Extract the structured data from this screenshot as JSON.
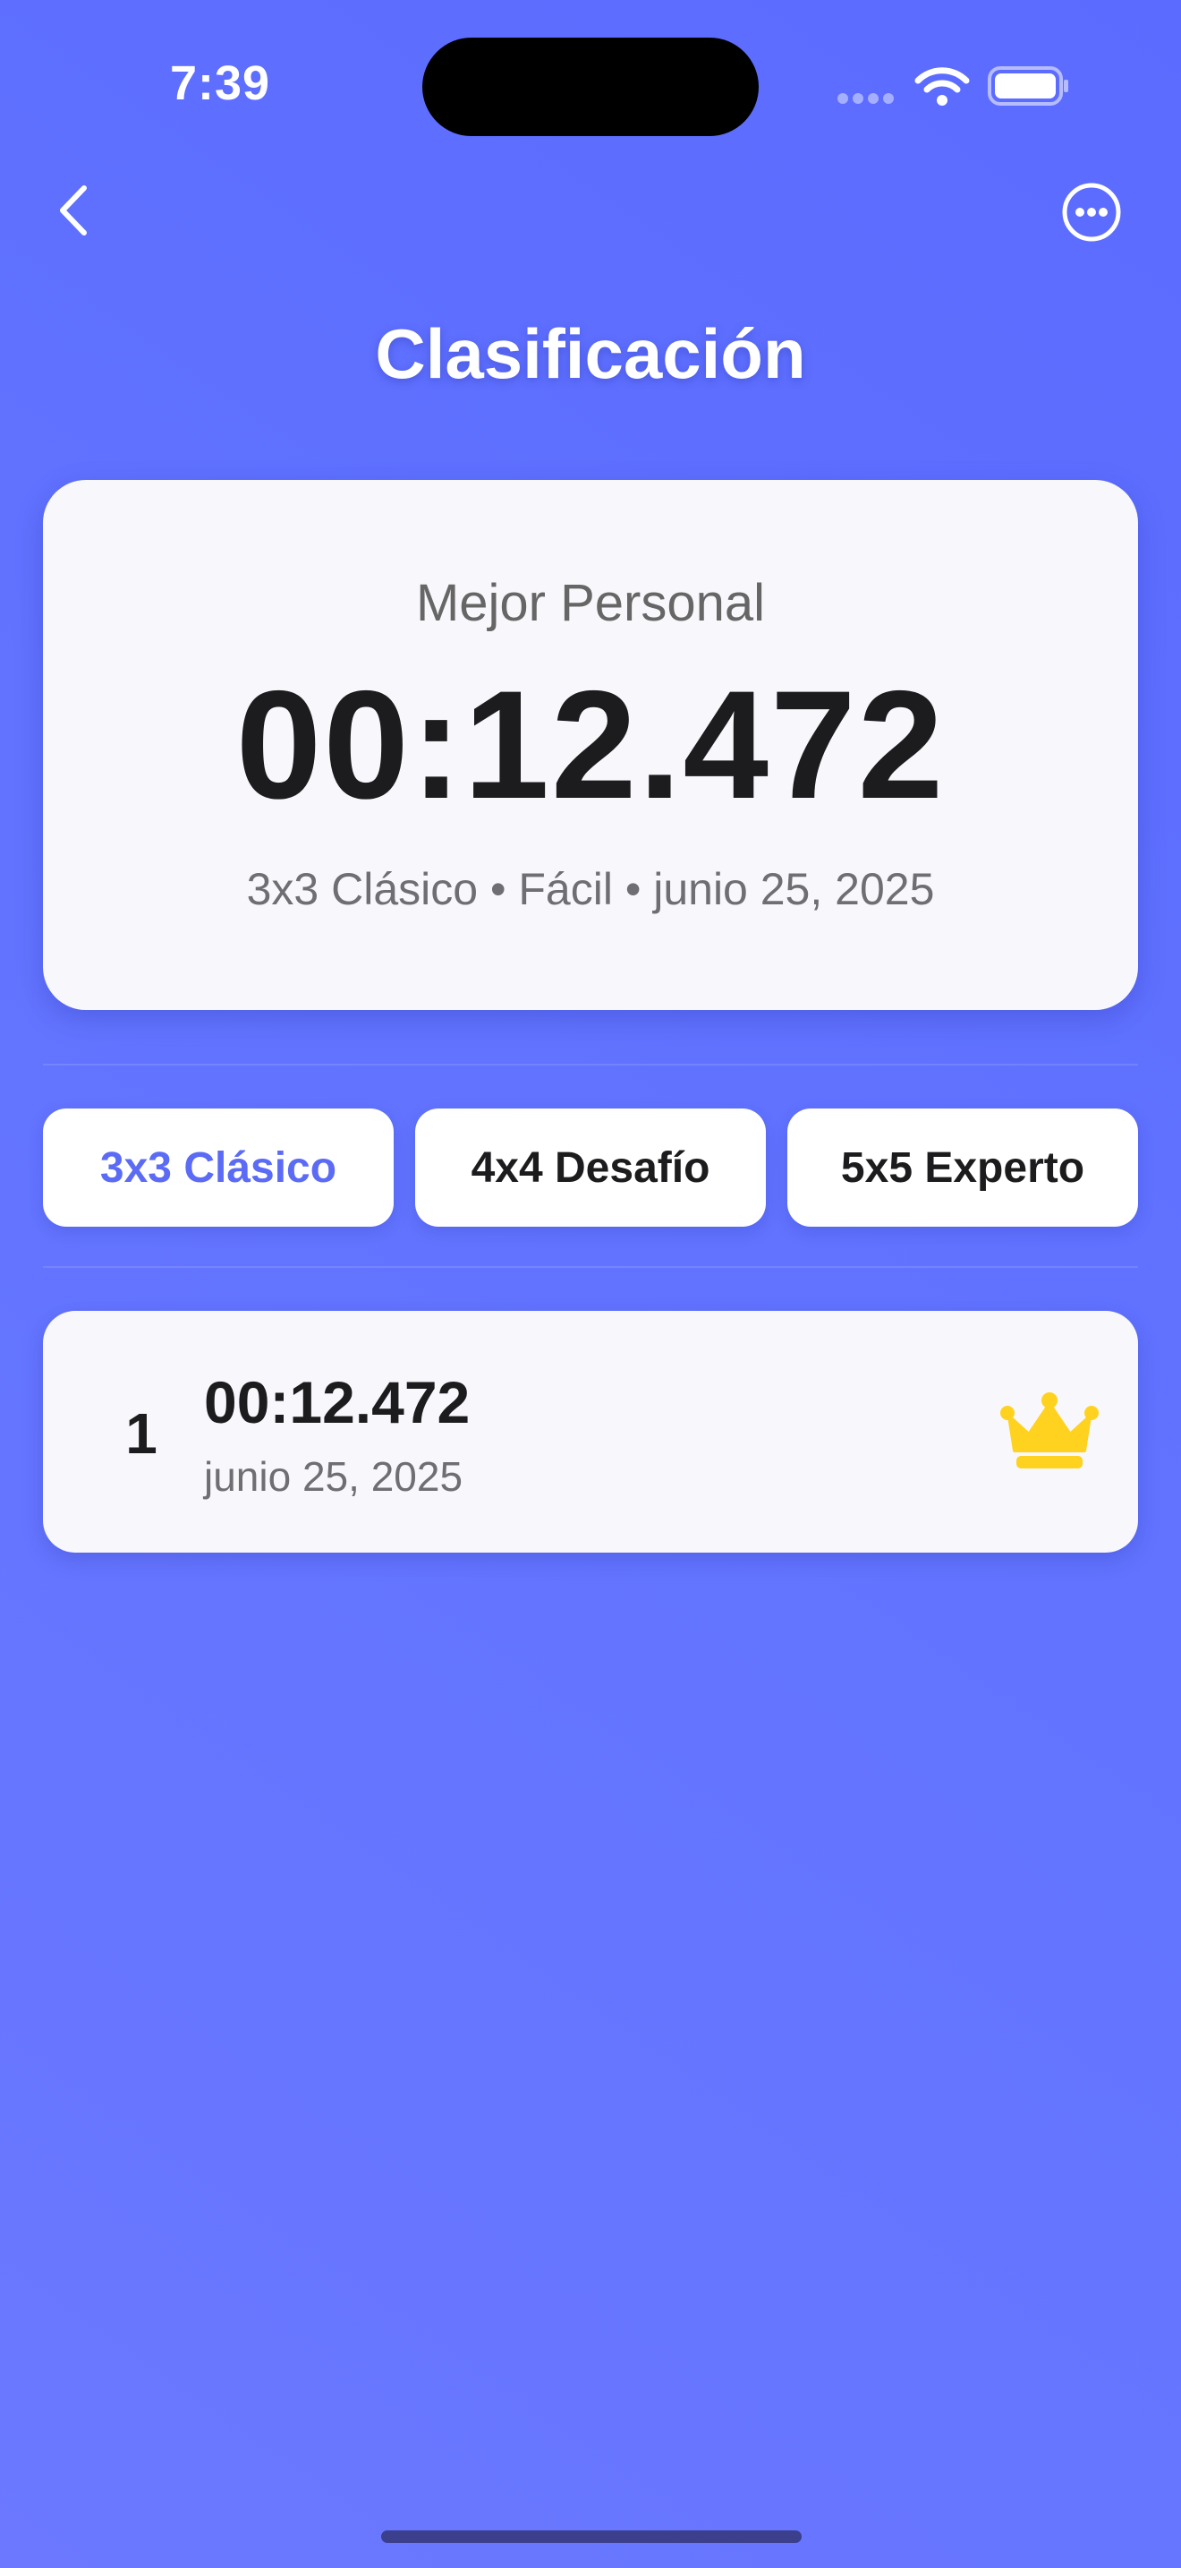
{
  "status_bar": {
    "time": "7:39",
    "icons": [
      "cellular-signal-icon",
      "wifi-icon",
      "battery-icon"
    ]
  },
  "nav": {
    "back_icon": "chevron-left-icon",
    "more_icon": "ellipsis-circle-icon",
    "title": "Clasificación"
  },
  "personal_best": {
    "label": "Mejor Personal",
    "time": "00:12.472",
    "meta": "3x3 Clásico • Fácil • junio 25, 2025"
  },
  "tabs": [
    {
      "label": "3x3 Clásico",
      "active": true
    },
    {
      "label": "4x4 Desafío",
      "active": false
    },
    {
      "label": "5x5 Experto",
      "active": false
    }
  ],
  "leaderboard": [
    {
      "rank": "1",
      "time": "00:12.472",
      "date": "junio 25, 2025",
      "icon": "crown-icon"
    }
  ],
  "colors": {
    "background": "#5b6bff",
    "accent": "#5b6bf5",
    "card": "#f8f8fc",
    "crown": "#ffd21f",
    "text_primary": "#1c1c1e",
    "text_secondary": "#6e6e73"
  }
}
